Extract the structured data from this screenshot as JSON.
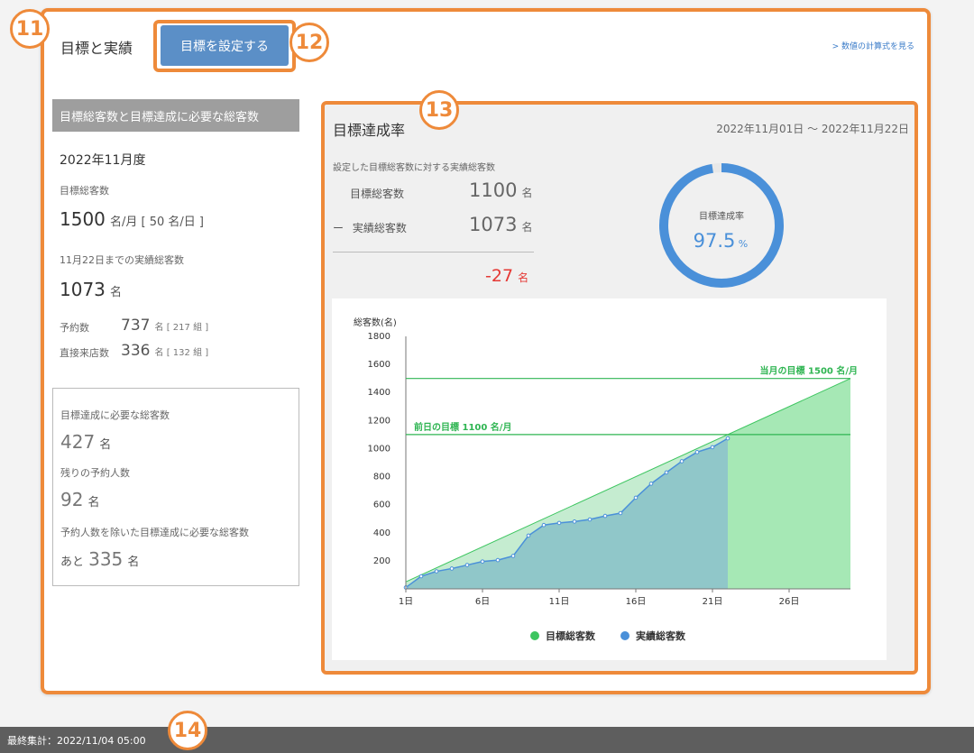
{
  "section": {
    "title": "目標と実績",
    "set_goal_button": "目標を設定する",
    "calc_link": "> 数値の計算式を見る"
  },
  "badges": {
    "b11": "11",
    "b12": "12",
    "b13": "13",
    "b14": "14"
  },
  "left": {
    "header": "目標総客数と目標達成に必要な総客数",
    "period": "2022年11月度",
    "target_label": "目標総客数",
    "target_value": "1500",
    "target_unit": "名/月 [ 50 名/日 ]",
    "actual_label": "11月22日までの実績総客数",
    "actual_value": "1073",
    "actual_unit": "名",
    "reserve_label": "予約数",
    "reserve_value": "737",
    "reserve_unit": "名 [ 217 組 ]",
    "walkin_label": "直接来店数",
    "walkin_value": "336",
    "walkin_unit": "名 [ 132 組 ]"
  },
  "need_box": {
    "need_label": "目標達成に必要な総客数",
    "need_value": "427",
    "need_unit": "名",
    "remain_label": "残りの予約人数",
    "remain_value": "92",
    "remain_unit": "名",
    "excl_label": "予約人数を除いた目標達成に必要な総客数",
    "excl_prefix": "あと",
    "excl_value": "335",
    "excl_unit": "名"
  },
  "rate": {
    "title": "目標達成率",
    "date_range": "2022年11月01日 〜 2022年11月22日",
    "desc": "設定した目標総客数に対する実績総客数",
    "target_label": "目標総客数",
    "target_value": "1100",
    "actual_prefix": "ー",
    "actual_label": "実績総客数",
    "actual_value": "1073",
    "unit": "名",
    "diff_value": "-27",
    "diff_unit": "名",
    "gauge_label": "目標達成率",
    "gauge_value": "97.5",
    "gauge_unit": "%",
    "gauge_fraction": 0.975
  },
  "colors": {
    "accent": "#ee8a3a",
    "button": "#5b8fc7",
    "target_green": "#3cc55f",
    "actual_blue": "#4a90d9",
    "negative": "#e53935"
  },
  "footer": {
    "last_aggregated": "最終集計：2022/11/04 05:00"
  },
  "chart_data": {
    "type": "area",
    "ylabel": "総客数(名)",
    "ylim": [
      0,
      1800
    ],
    "yticks": [
      200,
      400,
      600,
      800,
      1000,
      1200,
      1400,
      1600,
      1800
    ],
    "xlim": [
      1,
      30
    ],
    "xticks": [
      "1日",
      "6日",
      "11日",
      "16日",
      "21日",
      "26日"
    ],
    "xtick_days": [
      1,
      6,
      11,
      16,
      21,
      26
    ],
    "series": [
      {
        "name": "目標総客数",
        "color": "#3cc55f",
        "x": [
          1,
          30
        ],
        "y": [
          50,
          1500
        ]
      },
      {
        "name": "実績総客数",
        "color": "#4a90d9",
        "x": [
          1,
          2,
          3,
          4,
          5,
          6,
          7,
          8,
          9,
          10,
          11,
          12,
          13,
          14,
          15,
          16,
          17,
          18,
          19,
          20,
          21,
          22
        ],
        "y": [
          10,
          90,
          125,
          145,
          170,
          195,
          205,
          235,
          380,
          455,
          470,
          480,
          495,
          520,
          540,
          650,
          750,
          830,
          910,
          975,
          1010,
          1073
        ]
      }
    ],
    "reference_lines": [
      {
        "label": "前日の目標 1100 名/月",
        "value": 1100
      },
      {
        "label": "当月の目標 1500 名/月",
        "value": 1500
      }
    ],
    "current_day": 22,
    "legend_position": "bottom"
  }
}
